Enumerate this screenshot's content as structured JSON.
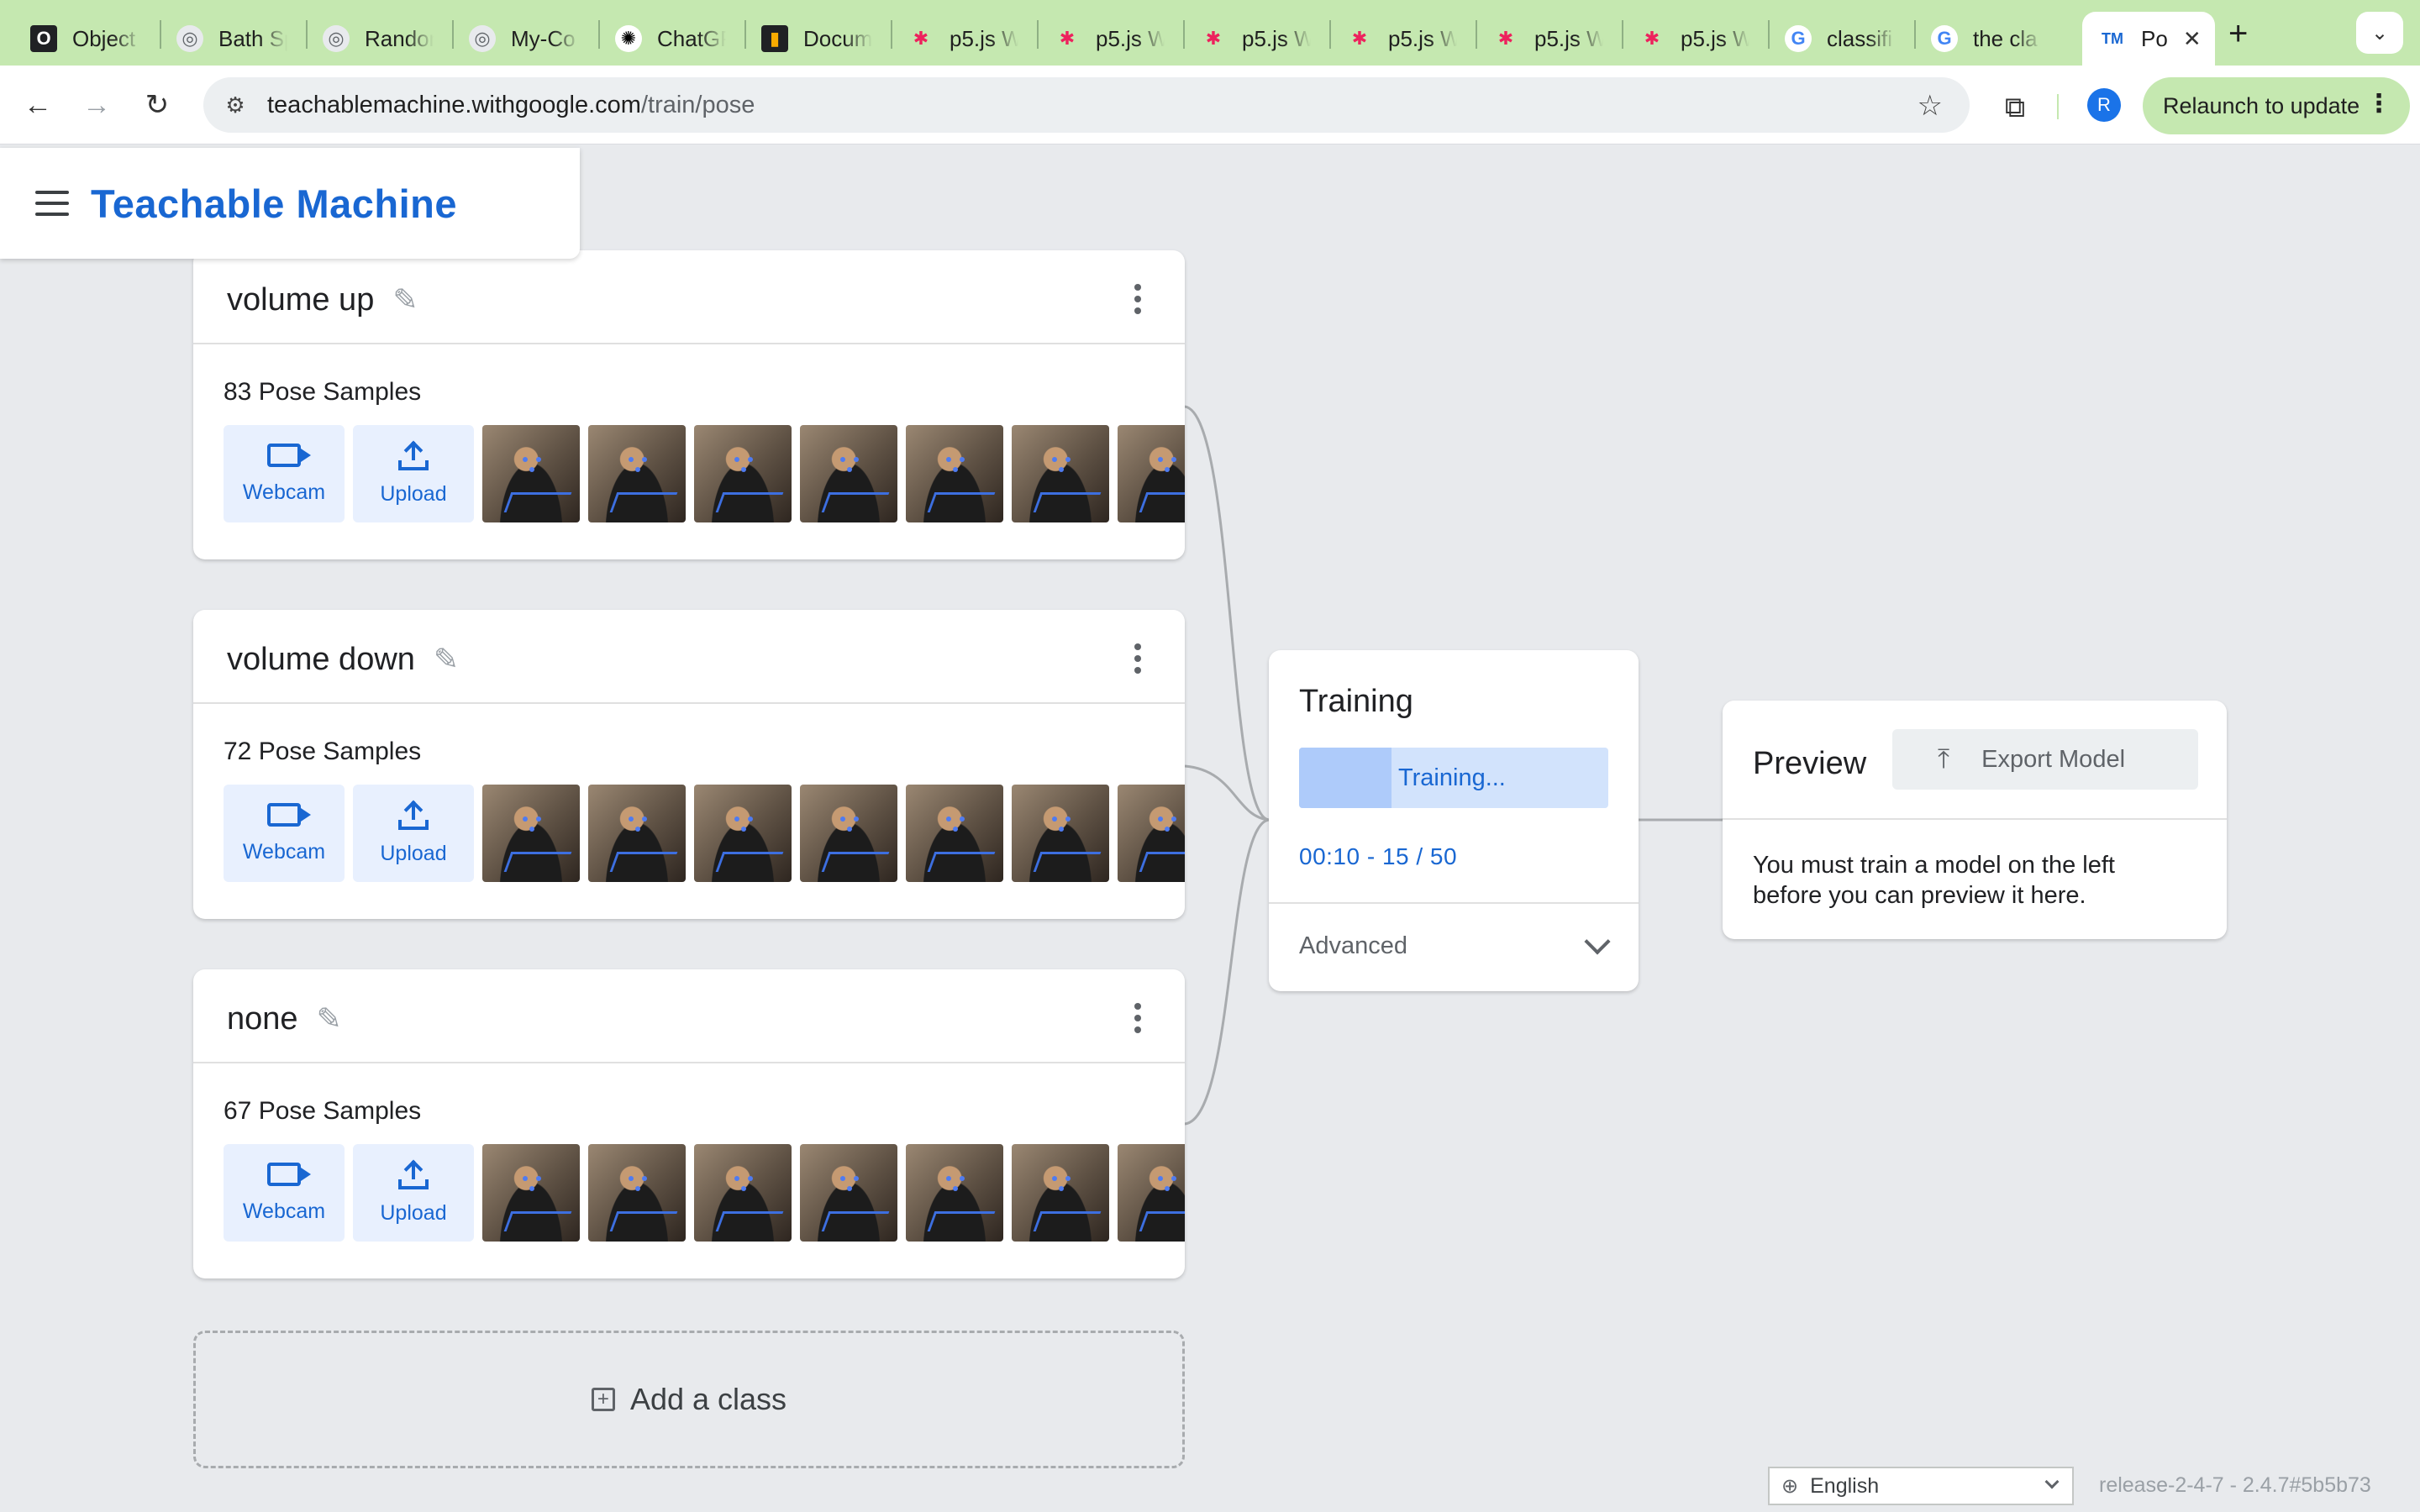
{
  "browser": {
    "tabs": [
      {
        "title": "Object",
        "favicon": "O",
        "fav_bg": "#202124",
        "fav_color": "#ffffff"
      },
      {
        "title": "Bath Sp",
        "favicon": "◎",
        "fav_bg": "#e8eaed",
        "fav_color": "#5f6368"
      },
      {
        "title": "Random",
        "favicon": "◎",
        "fav_bg": "#e8eaed",
        "fav_color": "#5f6368"
      },
      {
        "title": "My-Co",
        "favicon": "◎",
        "fav_bg": "#e8eaed",
        "fav_color": "#5f6368"
      },
      {
        "title": "ChatGPT",
        "favicon": "✺",
        "fav_bg": "#ffffff",
        "fav_color": "#000000"
      },
      {
        "title": "Docum",
        "favicon": "▮",
        "fav_bg": "#202124",
        "fav_color": "#f9ab00"
      },
      {
        "title": "p5.js W",
        "favicon": "✱",
        "fav_bg": "transparent",
        "fav_color": "#ed225d"
      },
      {
        "title": "p5.js W",
        "favicon": "✱",
        "fav_bg": "transparent",
        "fav_color": "#ed225d"
      },
      {
        "title": "p5.js W",
        "favicon": "✱",
        "fav_bg": "transparent",
        "fav_color": "#ed225d"
      },
      {
        "title": "p5.js W",
        "favicon": "✱",
        "fav_bg": "transparent",
        "fav_color": "#ed225d"
      },
      {
        "title": "p5.js W",
        "favicon": "✱",
        "fav_bg": "transparent",
        "fav_color": "#ed225d"
      },
      {
        "title": "p5.js W",
        "favicon": "✱",
        "fav_bg": "transparent",
        "fav_color": "#ed225d"
      },
      {
        "title": "classifi",
        "favicon": "G",
        "fav_bg": "#ffffff",
        "fav_color": "#4285f4"
      },
      {
        "title": "the cla",
        "favicon": "G",
        "fav_bg": "#ffffff",
        "fav_color": "#4285f4"
      }
    ],
    "active_tab": {
      "title": "Po",
      "favicon": "TM",
      "fav_color": "#1967d2",
      "close": "✕"
    },
    "new_tab_icon": "+",
    "tab_menu_icon": "⌄",
    "url_host": "teachablemachine.withgoogle.com",
    "url_path": "/train/pose",
    "profile_initial": "R",
    "relaunch_label": "Relaunch to update",
    "accent": "#c5e8b0"
  },
  "app": {
    "brand": "Teachable Machine",
    "brand_color": "#1967d2"
  },
  "classes": [
    {
      "name": "volume up",
      "samples_label": "83 Pose Samples",
      "webcam_label": "Webcam",
      "upload_label": "Upload"
    },
    {
      "name": "volume down",
      "samples_label": "72 Pose Samples",
      "webcam_label": "Webcam",
      "upload_label": "Upload"
    },
    {
      "name": "none",
      "samples_label": "67 Pose Samples",
      "webcam_label": "Webcam",
      "upload_label": "Upload"
    }
  ],
  "add_class_label": "Add a class",
  "training": {
    "title": "Training",
    "button_label": "Training...",
    "progress_fraction": 0.3,
    "stat": "00:10 - 15 / 50",
    "advanced_label": "Advanced"
  },
  "preview": {
    "title": "Preview",
    "export_label": "Export Model",
    "message": "You must train a model on the left before you can preview it here."
  },
  "footer": {
    "language": "English",
    "version": "release-2-4-7 - 2.4.7#5b5b73"
  }
}
